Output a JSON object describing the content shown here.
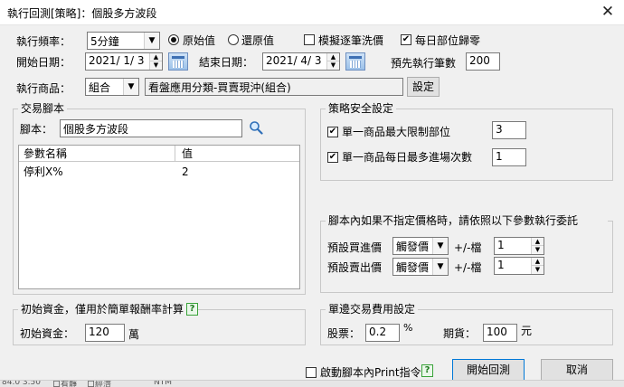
{
  "window": {
    "title": "執行回測[策略]：個股多方波段",
    "close_glyph": "✕"
  },
  "row1": {
    "freq_label": "執行頻率：",
    "freq_value": "5分鐘",
    "radio_original": "原始值",
    "radio_restored": "還原值",
    "simulate_label": "模擬逐筆洗價",
    "reset_label": "每日部位歸零"
  },
  "row2": {
    "start_label": "開始日期：",
    "start_value": "2021/ 1/ 3",
    "end_label": "結束日期：",
    "end_value": "2021/ 4/ 3",
    "prerun_label": "預先執行筆數",
    "prerun_value": "200"
  },
  "row3": {
    "product_label": "執行商品：",
    "product_value": "組合",
    "product_desc": "看盤應用分類-買賣現沖(組合)",
    "settings_label": "設定"
  },
  "script_group": {
    "title": "交易腳本",
    "script_label": "腳本：",
    "script_value": "個股多方波段",
    "col_param": "參數名稱",
    "col_value": "值",
    "rows": [
      {
        "name": "停利X%",
        "value": "2"
      }
    ]
  },
  "safety_group": {
    "title": "策略安全設定",
    "max_pos_label": "單一商品最大限制部位",
    "max_pos_value": "3",
    "max_entry_label": "單一商品每日最多進場次數",
    "max_entry_value": "1"
  },
  "price_group": {
    "title": "腳本內如果不指定價格時，請依照以下參數執行委託",
    "buy_label": "預設買進價",
    "buy_type": "觸發價",
    "buy_tick_label": "+/-檔",
    "buy_tick_value": "1",
    "sell_label": "預設賣出價",
    "sell_type": "觸發價",
    "sell_tick_label": "+/-檔",
    "sell_tick_value": "1"
  },
  "capital_group": {
    "title": "初始資金，僅用於簡單報酬率計算",
    "capital_label": "初始資金：",
    "capital_value": "120",
    "capital_unit": "萬"
  },
  "fee_group": {
    "title": "單邊交易費用設定",
    "stock_label": "股票：",
    "stock_value": "0.2",
    "stock_unit": "%",
    "futures_label": "期貨：",
    "futures_value": "100",
    "futures_unit": "元"
  },
  "footer": {
    "print_label": "啟動腳本內Print指令",
    "run_label": "開始回測",
    "cancel_label": "取消",
    "strip_texts": [
      "84.0 3.50",
      "口有靜",
      "口經濟",
      "NTM"
    ]
  },
  "icons": {
    "help": "?",
    "check": "✔",
    "arrow_down": "▼",
    "spin_up": "▲",
    "spin_down": "▼"
  }
}
